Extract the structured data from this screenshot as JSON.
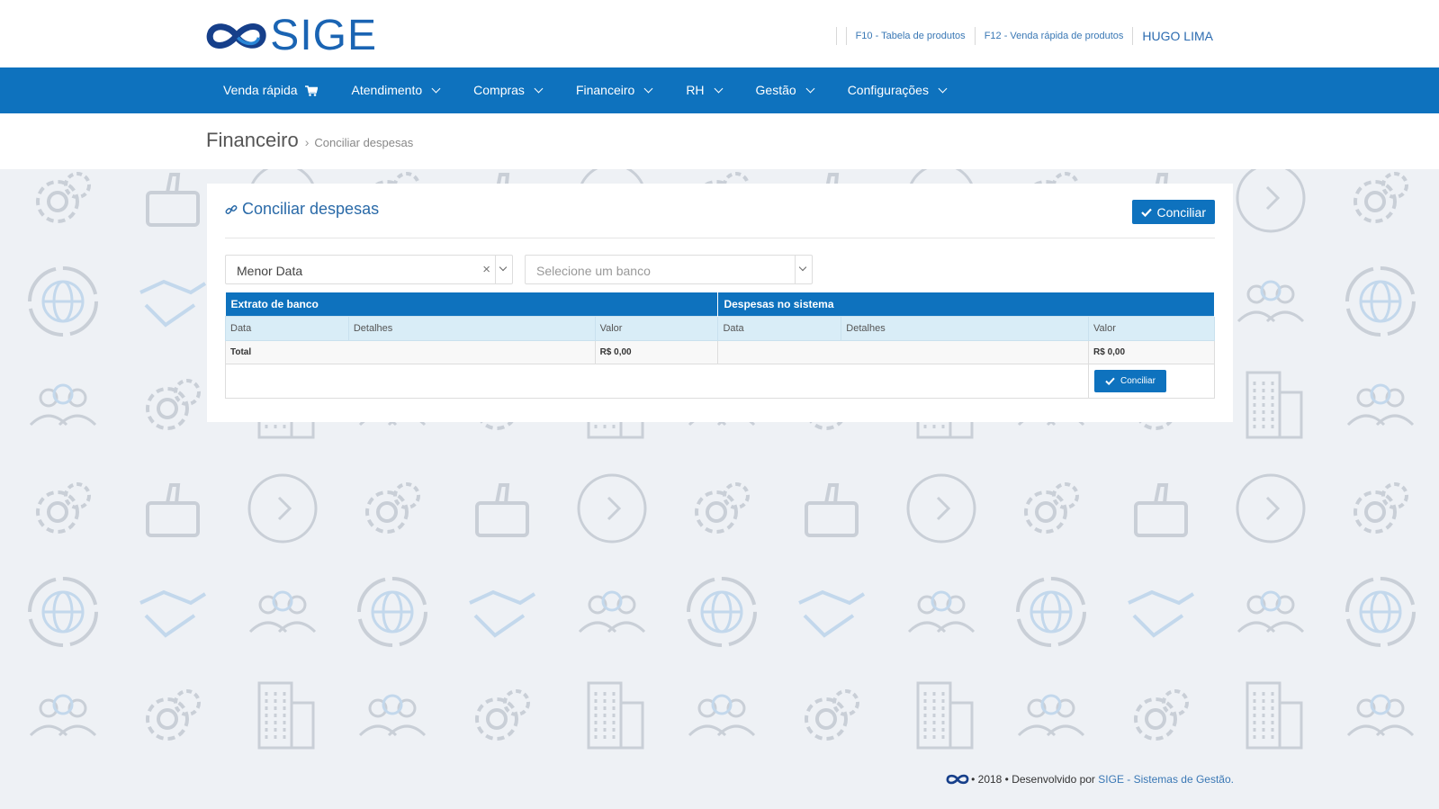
{
  "app": {
    "logo_text": "SIGE"
  },
  "header": {
    "shortcut_products": "F10 - Tabela de produtos",
    "shortcut_quick_sale": "F12 - Venda rápida de produtos",
    "user_name": "HUGO LIMA"
  },
  "nav": {
    "items": [
      {
        "label": "Venda rápida",
        "icon": "cart-icon"
      },
      {
        "label": "Atendimento",
        "icon": "chevron-down-icon"
      },
      {
        "label": "Compras",
        "icon": "chevron-down-icon"
      },
      {
        "label": "Financeiro",
        "icon": "chevron-down-icon"
      },
      {
        "label": "RH",
        "icon": "chevron-down-icon"
      },
      {
        "label": "Gestão",
        "icon": "chevron-down-icon"
      },
      {
        "label": "Configurações",
        "icon": "chevron-down-icon"
      }
    ]
  },
  "breadcrumb": {
    "section": "Financeiro",
    "separator": "›",
    "page": "Conciliar despesas"
  },
  "panel": {
    "title": "Conciliar despesas",
    "title_icon": "link-icon",
    "conciliar_label": "Conciliar",
    "filter_order": {
      "value": "Menor Data",
      "clear": "×"
    },
    "filter_bank": {
      "placeholder": "Selecione um banco"
    }
  },
  "table": {
    "group_bank": "Extrato de banco",
    "group_system": "Despesas no sistema",
    "columns": {
      "date": "Data",
      "details": "Detalhes",
      "value": "Valor"
    },
    "total_label": "Total",
    "total_bank": "R$ 0,00",
    "total_system": "R$ 0,00",
    "action_label": "Conciliar"
  },
  "footer": {
    "prefix": "• 2018 • Desenvolvido por ",
    "link": "SIGE - Sistemas de Gestão."
  },
  "colors": {
    "primary": "#0e72be",
    "link": "#3a78b5",
    "table_head": "#d9edf7",
    "background": "#eef1f5"
  }
}
